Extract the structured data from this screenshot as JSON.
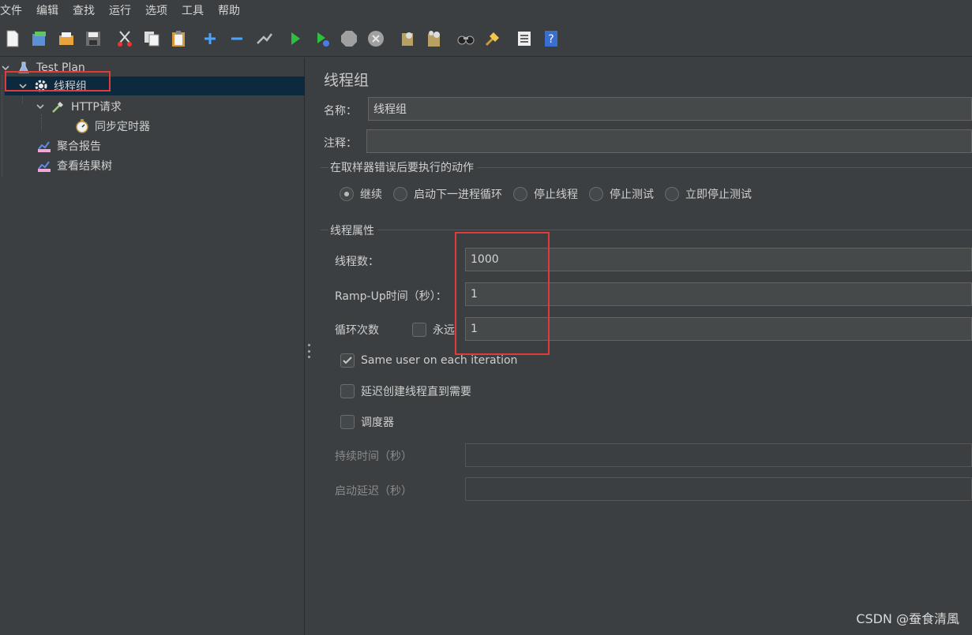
{
  "menu": [
    "文件",
    "编辑",
    "查找",
    "运行",
    "选项",
    "工具",
    "帮助"
  ],
  "toolbar_icons": [
    "new-icon",
    "templates-icon",
    "open-icon",
    "save-icon",
    "cut-icon",
    "copy-icon",
    "paste-icon",
    "add-icon",
    "remove-icon",
    "toggle-icon",
    "start-icon",
    "start-no-pause-icon",
    "stop-icon",
    "shutdown-icon",
    "clear-icon",
    "clear-all-icon",
    "search-icon",
    "reset-search-icon",
    "function-helper-icon",
    "help-icon"
  ],
  "tree": {
    "test_plan": "Test Plan",
    "thread_group": "线程组",
    "http_request": "HTTP请求",
    "sync_timer": "同步定时器",
    "aggregate_report": "聚合报告",
    "view_results_tree": "查看结果树"
  },
  "panel": {
    "title": "线程组",
    "name_label": "名称：",
    "name_value": "线程组",
    "comment_label": "注释：",
    "comment_value": "",
    "error_section": "在取样器错误后要执行的动作",
    "error_options": [
      "继续",
      "启动下一进程循环",
      "停止线程",
      "停止测试",
      "立即停止测试"
    ],
    "error_selected": 0,
    "props_section": "线程属性",
    "threads_label": "线程数：",
    "threads_value": "1000",
    "rampup_label": "Ramp-Up时间（秒）：",
    "rampup_value": "1",
    "loop_label": "循环次数",
    "forever_label": "永远",
    "loop_value": "1",
    "same_user_label": "Same user on each iteration",
    "same_user_checked": true,
    "delay_label": "延迟创建线程直到需要",
    "scheduler_label": "调度器",
    "duration_label": "持续时间（秒）",
    "startup_delay_label": "启动延迟（秒）"
  },
  "watermark": "CSDN @蚕食清風",
  "colors": {
    "highlight": "#e03b3b",
    "selection": "#0d293e",
    "background": "#3c3f41"
  }
}
